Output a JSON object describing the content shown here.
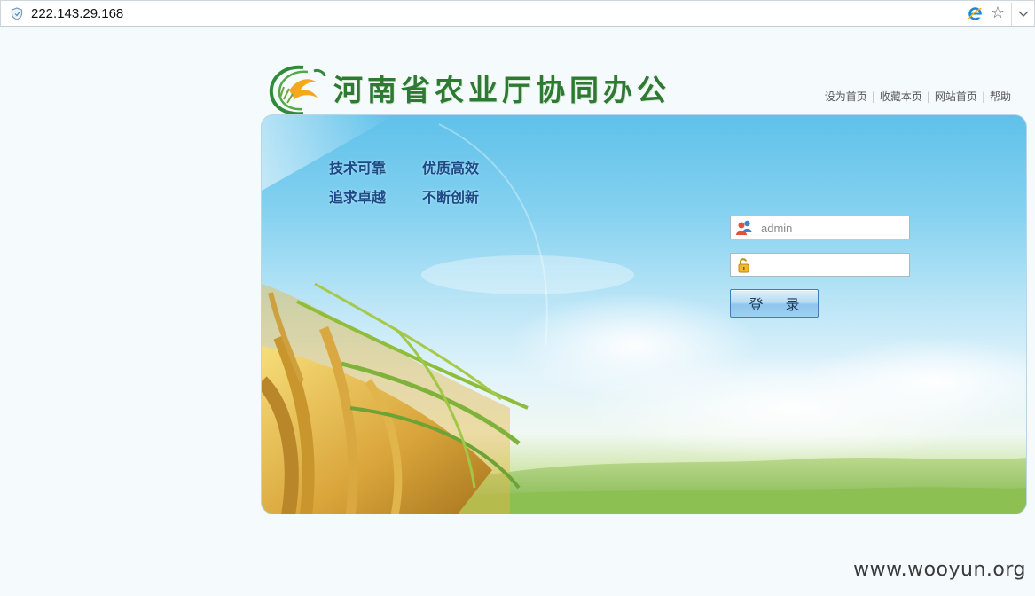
{
  "browser": {
    "url": "222.143.29.168"
  },
  "site": {
    "title": "河南省农业厅协同办公"
  },
  "toplinks": [
    {
      "label": "设为首页"
    },
    {
      "label": "收藏本页"
    },
    {
      "label": "网站首页"
    },
    {
      "label": "帮助"
    }
  ],
  "slogans": {
    "line1_left": "技术可靠",
    "line1_right": "优质高效",
    "line2_left": "追求卓越",
    "line2_right": "不断创新"
  },
  "login": {
    "username_placeholder": "admin",
    "password_value": "",
    "submit_label": "登 录"
  },
  "watermark": "www.wooyun.org",
  "colors": {
    "title_green": "#2f7a32",
    "slogan_blue": "#1c4a86",
    "sky_blue": "#5fc1ea"
  }
}
